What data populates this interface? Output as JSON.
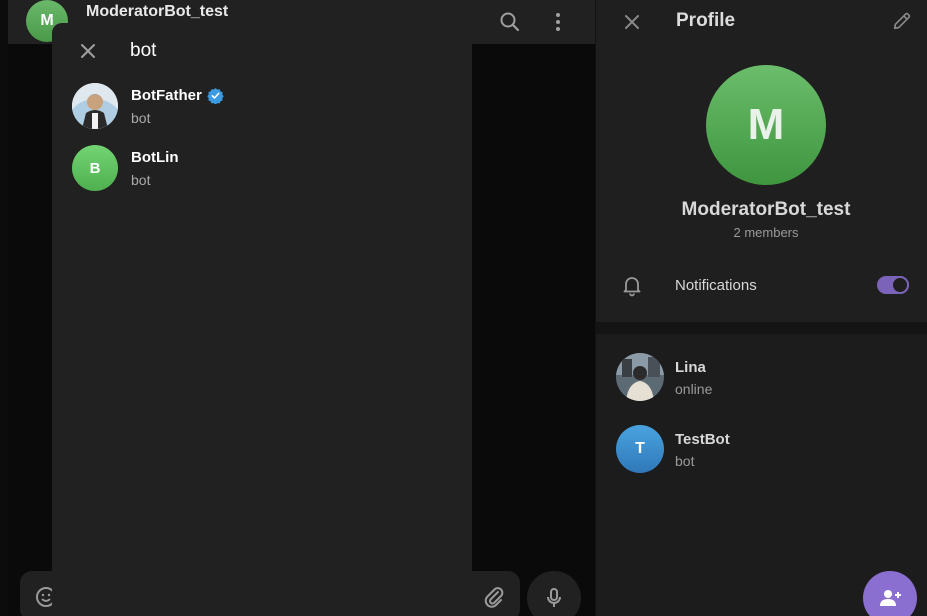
{
  "chat": {
    "avatar_letter": "M",
    "title": "ModeratorBot_test"
  },
  "search": {
    "query": "bot",
    "results": [
      {
        "name": "BotFather",
        "subtitle": "bot",
        "verified": true
      },
      {
        "name": "BotLin",
        "subtitle": "bot",
        "avatar_letter": "B"
      }
    ]
  },
  "profile": {
    "title": "Profile",
    "avatar_letter": "M",
    "name": "ModeratorBot_test",
    "members": "2 members",
    "notifications_label": "Notifications",
    "notifications_on": true,
    "member_list": [
      {
        "name": "Lina",
        "status": "online"
      },
      {
        "name": "TestBot",
        "status": "bot",
        "avatar_letter": "T"
      }
    ]
  },
  "colors": {
    "accent": "#8a6ed0",
    "verified": "#3a9be3",
    "green_avatar": "#4a9a4a",
    "blue_avatar": "#3a8dc9"
  }
}
